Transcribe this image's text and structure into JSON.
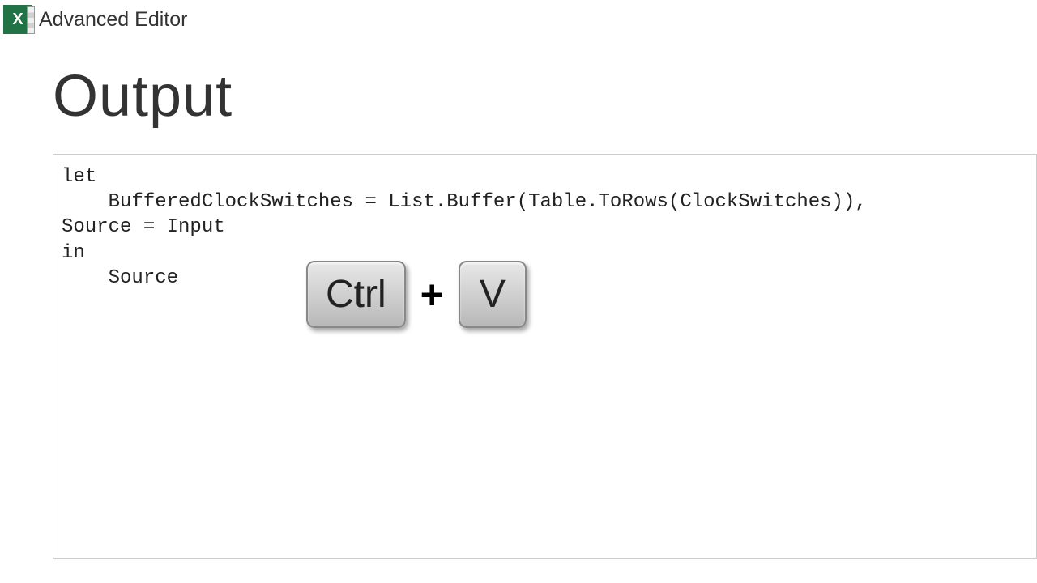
{
  "window": {
    "title": "Advanced Editor"
  },
  "query": {
    "name": "Output"
  },
  "code": {
    "content": "let\n    BufferedClockSwitches = List.Buffer(Table.ToRows(ClockSwitches)),\nSource = Input\nin\n    Source"
  },
  "shortcut": {
    "key1": "Ctrl",
    "plus": "+",
    "key2": "V"
  },
  "icons": {
    "excel": "X"
  }
}
